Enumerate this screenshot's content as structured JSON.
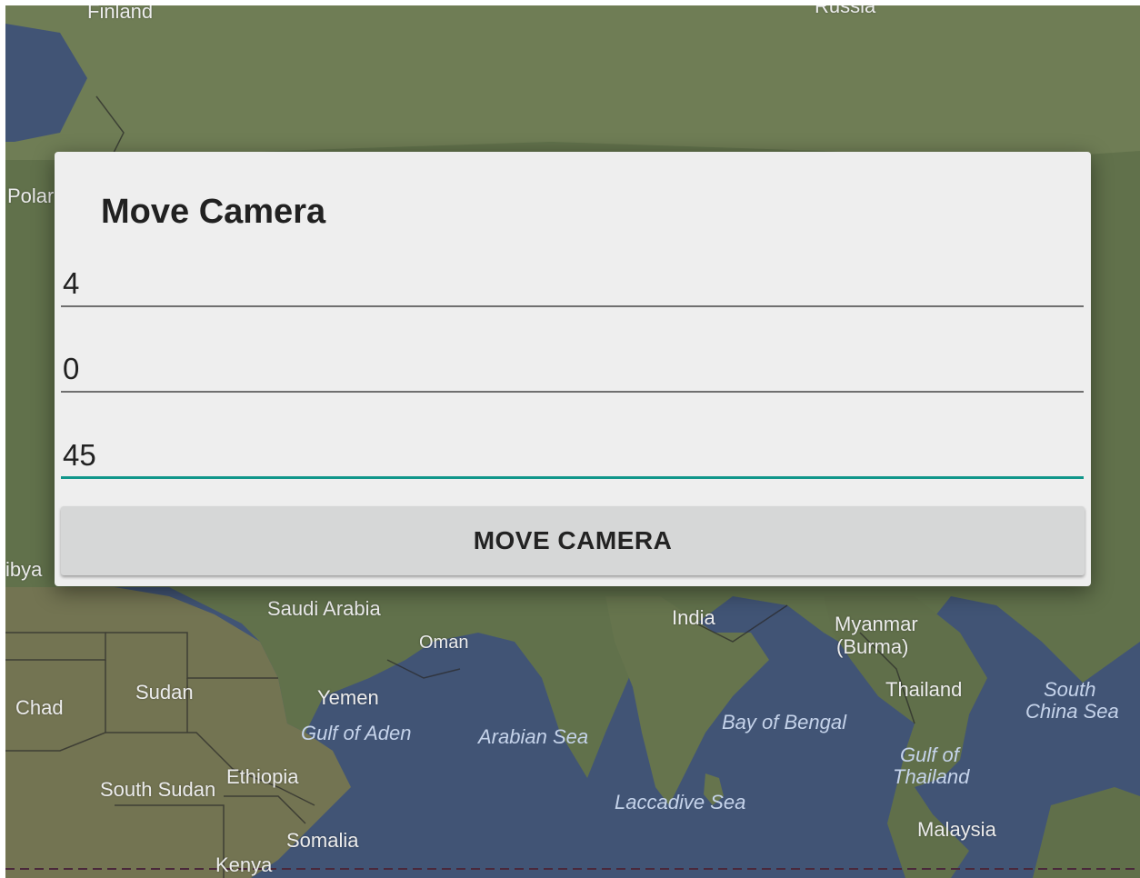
{
  "map": {
    "labels": {
      "finland": "Finland",
      "russia": "Russia",
      "poland": "Polar",
      "libya": "ibya",
      "saudi_arabia": "Saudi Arabia",
      "oman": "Oman",
      "india": "India",
      "myanmar": "Myanmar",
      "burma": "(Burma)",
      "sudan": "Sudan",
      "chad": "Chad",
      "yemen": "Yemen",
      "gulf_of_aden": "Gulf of Aden",
      "arabian_sea": "Arabian Sea",
      "bay_of_bengal": "Bay of Bengal",
      "thailand": "Thailand",
      "south_china_sea_1": "South",
      "south_china_sea_2": "China Sea",
      "gulf_of_thailand_1": "Gulf of",
      "gulf_of_thailand_2": "Thailand",
      "south_sudan": "South Sudan",
      "ethiopia": "Ethiopia",
      "laccadive_sea": "Laccadive Sea",
      "malaysia": "Malaysia",
      "somalia": "Somalia",
      "kenya": "Kenya"
    }
  },
  "dialog": {
    "title": "Move Camera",
    "fields": [
      {
        "value": "4"
      },
      {
        "value": "0"
      },
      {
        "value": "45"
      }
    ],
    "move_button_label": "MOVE CAMERA",
    "accent_color": "#10968a"
  }
}
